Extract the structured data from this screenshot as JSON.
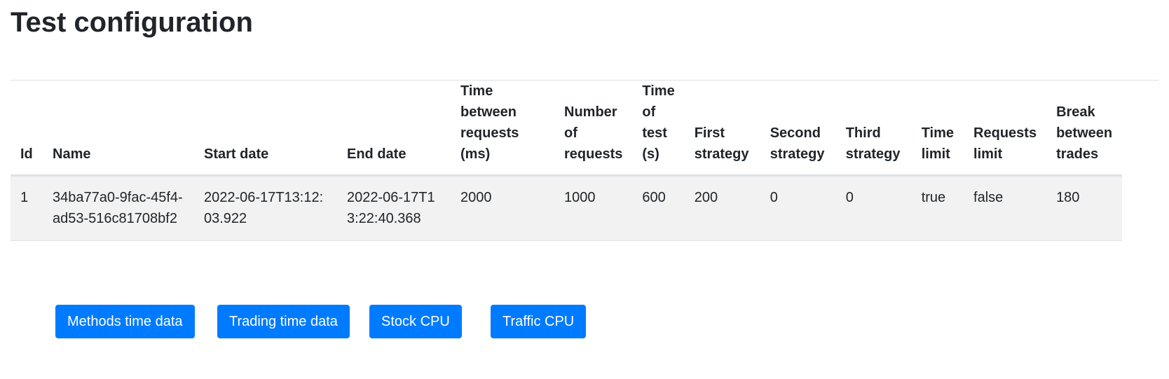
{
  "page": {
    "title": "Test configuration"
  },
  "table": {
    "headers": [
      "Id",
      "Name",
      "Start date",
      "End date",
      "Time between requests (ms)",
      "Number of requests",
      "Time of test (s)",
      "First strategy",
      "Second strategy",
      "Third strategy",
      "Time limit",
      "Requests limit",
      "Break between trades"
    ],
    "rows": [
      [
        "1",
        "34ba77a0-9fac-45f4-ad53-516c81708bf2",
        "2022-06-17T13:12:03.922",
        "2022-06-17T13:22:40.368",
        "2000",
        "1000",
        "600",
        "200",
        "0",
        "0",
        "true",
        "false",
        "180"
      ]
    ]
  },
  "buttons": {
    "methods_time_data": "Methods time data",
    "trading_time_data": "Trading time data",
    "stock_cpu": "Stock CPU",
    "traffic_cpu": "Traffic CPU"
  },
  "colors": {
    "primary": "#007bff",
    "row_background": "#f2f2f2",
    "border": "#dee2e6",
    "text": "#212529"
  }
}
